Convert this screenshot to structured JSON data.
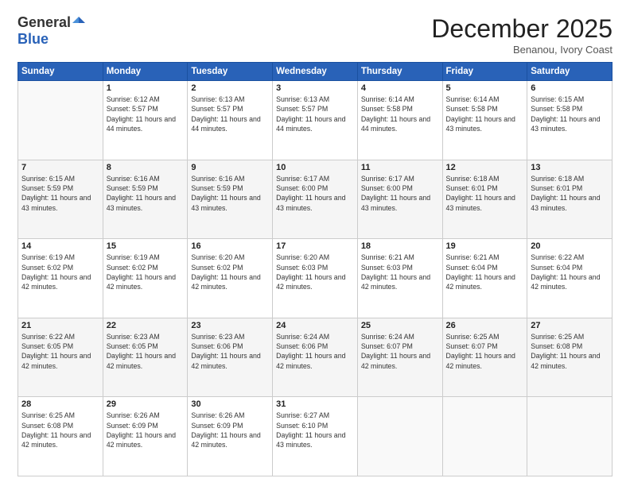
{
  "logo": {
    "general": "General",
    "blue": "Blue"
  },
  "header": {
    "month": "December 2025",
    "location": "Benanou, Ivory Coast"
  },
  "days_of_week": [
    "Sunday",
    "Monday",
    "Tuesday",
    "Wednesday",
    "Thursday",
    "Friday",
    "Saturday"
  ],
  "weeks": [
    [
      {
        "day": "",
        "sunrise": "",
        "sunset": "",
        "daylight": ""
      },
      {
        "day": "1",
        "sunrise": "Sunrise: 6:12 AM",
        "sunset": "Sunset: 5:57 PM",
        "daylight": "Daylight: 11 hours and 44 minutes."
      },
      {
        "day": "2",
        "sunrise": "Sunrise: 6:13 AM",
        "sunset": "Sunset: 5:57 PM",
        "daylight": "Daylight: 11 hours and 44 minutes."
      },
      {
        "day": "3",
        "sunrise": "Sunrise: 6:13 AM",
        "sunset": "Sunset: 5:57 PM",
        "daylight": "Daylight: 11 hours and 44 minutes."
      },
      {
        "day": "4",
        "sunrise": "Sunrise: 6:14 AM",
        "sunset": "Sunset: 5:58 PM",
        "daylight": "Daylight: 11 hours and 44 minutes."
      },
      {
        "day": "5",
        "sunrise": "Sunrise: 6:14 AM",
        "sunset": "Sunset: 5:58 PM",
        "daylight": "Daylight: 11 hours and 43 minutes."
      },
      {
        "day": "6",
        "sunrise": "Sunrise: 6:15 AM",
        "sunset": "Sunset: 5:58 PM",
        "daylight": "Daylight: 11 hours and 43 minutes."
      }
    ],
    [
      {
        "day": "7",
        "sunrise": "Sunrise: 6:15 AM",
        "sunset": "Sunset: 5:59 PM",
        "daylight": "Daylight: 11 hours and 43 minutes."
      },
      {
        "day": "8",
        "sunrise": "Sunrise: 6:16 AM",
        "sunset": "Sunset: 5:59 PM",
        "daylight": "Daylight: 11 hours and 43 minutes."
      },
      {
        "day": "9",
        "sunrise": "Sunrise: 6:16 AM",
        "sunset": "Sunset: 5:59 PM",
        "daylight": "Daylight: 11 hours and 43 minutes."
      },
      {
        "day": "10",
        "sunrise": "Sunrise: 6:17 AM",
        "sunset": "Sunset: 6:00 PM",
        "daylight": "Daylight: 11 hours and 43 minutes."
      },
      {
        "day": "11",
        "sunrise": "Sunrise: 6:17 AM",
        "sunset": "Sunset: 6:00 PM",
        "daylight": "Daylight: 11 hours and 43 minutes."
      },
      {
        "day": "12",
        "sunrise": "Sunrise: 6:18 AM",
        "sunset": "Sunset: 6:01 PM",
        "daylight": "Daylight: 11 hours and 43 minutes."
      },
      {
        "day": "13",
        "sunrise": "Sunrise: 6:18 AM",
        "sunset": "Sunset: 6:01 PM",
        "daylight": "Daylight: 11 hours and 43 minutes."
      }
    ],
    [
      {
        "day": "14",
        "sunrise": "Sunrise: 6:19 AM",
        "sunset": "Sunset: 6:02 PM",
        "daylight": "Daylight: 11 hours and 42 minutes."
      },
      {
        "day": "15",
        "sunrise": "Sunrise: 6:19 AM",
        "sunset": "Sunset: 6:02 PM",
        "daylight": "Daylight: 11 hours and 42 minutes."
      },
      {
        "day": "16",
        "sunrise": "Sunrise: 6:20 AM",
        "sunset": "Sunset: 6:02 PM",
        "daylight": "Daylight: 11 hours and 42 minutes."
      },
      {
        "day": "17",
        "sunrise": "Sunrise: 6:20 AM",
        "sunset": "Sunset: 6:03 PM",
        "daylight": "Daylight: 11 hours and 42 minutes."
      },
      {
        "day": "18",
        "sunrise": "Sunrise: 6:21 AM",
        "sunset": "Sunset: 6:03 PM",
        "daylight": "Daylight: 11 hours and 42 minutes."
      },
      {
        "day": "19",
        "sunrise": "Sunrise: 6:21 AM",
        "sunset": "Sunset: 6:04 PM",
        "daylight": "Daylight: 11 hours and 42 minutes."
      },
      {
        "day": "20",
        "sunrise": "Sunrise: 6:22 AM",
        "sunset": "Sunset: 6:04 PM",
        "daylight": "Daylight: 11 hours and 42 minutes."
      }
    ],
    [
      {
        "day": "21",
        "sunrise": "Sunrise: 6:22 AM",
        "sunset": "Sunset: 6:05 PM",
        "daylight": "Daylight: 11 hours and 42 minutes."
      },
      {
        "day": "22",
        "sunrise": "Sunrise: 6:23 AM",
        "sunset": "Sunset: 6:05 PM",
        "daylight": "Daylight: 11 hours and 42 minutes."
      },
      {
        "day": "23",
        "sunrise": "Sunrise: 6:23 AM",
        "sunset": "Sunset: 6:06 PM",
        "daylight": "Daylight: 11 hours and 42 minutes."
      },
      {
        "day": "24",
        "sunrise": "Sunrise: 6:24 AM",
        "sunset": "Sunset: 6:06 PM",
        "daylight": "Daylight: 11 hours and 42 minutes."
      },
      {
        "day": "25",
        "sunrise": "Sunrise: 6:24 AM",
        "sunset": "Sunset: 6:07 PM",
        "daylight": "Daylight: 11 hours and 42 minutes."
      },
      {
        "day": "26",
        "sunrise": "Sunrise: 6:25 AM",
        "sunset": "Sunset: 6:07 PM",
        "daylight": "Daylight: 11 hours and 42 minutes."
      },
      {
        "day": "27",
        "sunrise": "Sunrise: 6:25 AM",
        "sunset": "Sunset: 6:08 PM",
        "daylight": "Daylight: 11 hours and 42 minutes."
      }
    ],
    [
      {
        "day": "28",
        "sunrise": "Sunrise: 6:25 AM",
        "sunset": "Sunset: 6:08 PM",
        "daylight": "Daylight: 11 hours and 42 minutes."
      },
      {
        "day": "29",
        "sunrise": "Sunrise: 6:26 AM",
        "sunset": "Sunset: 6:09 PM",
        "daylight": "Daylight: 11 hours and 42 minutes."
      },
      {
        "day": "30",
        "sunrise": "Sunrise: 6:26 AM",
        "sunset": "Sunset: 6:09 PM",
        "daylight": "Daylight: 11 hours and 42 minutes."
      },
      {
        "day": "31",
        "sunrise": "Sunrise: 6:27 AM",
        "sunset": "Sunset: 6:10 PM",
        "daylight": "Daylight: 11 hours and 43 minutes."
      },
      {
        "day": "",
        "sunrise": "",
        "sunset": "",
        "daylight": ""
      },
      {
        "day": "",
        "sunrise": "",
        "sunset": "",
        "daylight": ""
      },
      {
        "day": "",
        "sunrise": "",
        "sunset": "",
        "daylight": ""
      }
    ]
  ]
}
